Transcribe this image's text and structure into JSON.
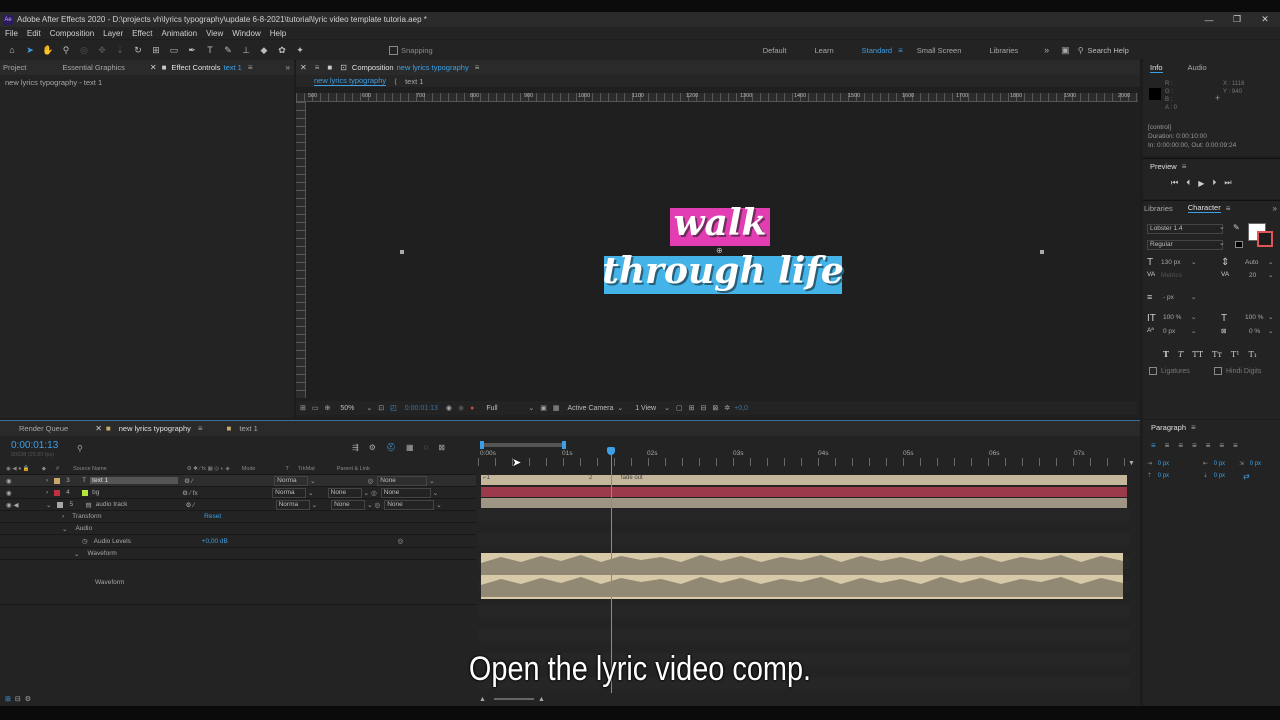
{
  "window": {
    "title": "Adobe After Effects 2020 - D:\\projects vh\\lyrics typography\\update 6-8-2021\\tutorial\\lyric video template tutoria.aep *",
    "app_icon": "Ae",
    "minimize": "—",
    "maximize": "❐",
    "close": "✕"
  },
  "menu": [
    "File",
    "Edit",
    "Composition",
    "Layer",
    "Effect",
    "Animation",
    "View",
    "Window",
    "Help"
  ],
  "toolbar": {
    "snapping_label": "Snapping",
    "workspaces": [
      "Default",
      "Learn",
      "Standard",
      "Small Screen",
      "Libraries"
    ],
    "active_workspace": "Standard",
    "search_placeholder": "Search Help"
  },
  "left_panel": {
    "tabs": [
      "Project",
      "Essential Graphics",
      "Effect Controls"
    ],
    "effect_controls_target": "text 1",
    "breadcrumb": "new lyrics typography - text 1"
  },
  "composition": {
    "tab_label": "Composition",
    "tab_target": "new lyrics typography",
    "nav_items": [
      "new lyrics typography",
      "text 1"
    ],
    "canvas_text_line1": "walk",
    "canvas_text_line2": "through life",
    "footer": {
      "zoom": "50%",
      "timecode": "0:00:01:13",
      "resolution": "Full",
      "camera": "Active Camera",
      "views": "1 View",
      "exposure": "+0,0"
    },
    "ruler_labels": [
      "500",
      "600",
      "700",
      "800",
      "900",
      "1000",
      "1100",
      "1200",
      "1300",
      "1400",
      "1500",
      "1600",
      "1700",
      "1800",
      "1900",
      "2000"
    ]
  },
  "info_panel": {
    "tabs": [
      "Info",
      "Audio"
    ],
    "rgb": [
      "R :",
      "G :",
      "B :",
      "A : 0"
    ],
    "xy": [
      "X : 1116",
      "Y : 940"
    ],
    "layer_info": [
      "[control]",
      "Duration: 0:00:10:00",
      "In: 0:00:00:00, Out: 0:00:09:24"
    ]
  },
  "preview_panel": {
    "title": "Preview"
  },
  "character_panel": {
    "tabs": [
      "Libraries",
      "Character"
    ],
    "font": "Lobster 1.4",
    "style": "Regular",
    "size": "130 px",
    "leading": "Auto",
    "kerning": "Metrics",
    "tracking": "20",
    "stroke": "- px",
    "vscale": "100 %",
    "hscale": "100 %",
    "baseline": "0 px",
    "tsume": "0 %",
    "style_buttons": [
      "T",
      "T",
      "TT",
      "Tᴛ",
      "T¹",
      "T₁"
    ],
    "ligatures": "Ligatures",
    "hindi_digits": "Hindi Digits"
  },
  "paragraph_panel": {
    "title": "Paragraph",
    "values": [
      "0 px",
      "0 px",
      "0 px",
      "0 px",
      "0 px"
    ]
  },
  "timeline": {
    "tabs": [
      "Render Queue",
      "new lyrics typography",
      "text 1"
    ],
    "timecode": "0:00:01:13",
    "frame_info": "00038 (25.00 fps)",
    "columns": [
      "Source Name",
      "Mode",
      "T",
      "TrkMat",
      "Parent & Link"
    ],
    "layers": [
      {
        "num": "3",
        "name": "text 1",
        "mode": "Norma",
        "trkmat": "",
        "parent": "None",
        "color": "#c8a96a"
      },
      {
        "num": "4",
        "name": "bg",
        "mode": "Norma",
        "trkmat": "None",
        "parent": "None",
        "color": "#b3e63d"
      },
      {
        "num": "5",
        "name": "audio track",
        "mode": "Norma",
        "trkmat": "None",
        "parent": "None",
        "color": "#a8a8a8"
      }
    ],
    "props": {
      "transform": "Transform",
      "reset": "Reset",
      "audio": "Audio",
      "audio_levels": "Audio Levels",
      "audio_levels_value": "+0,00 dB",
      "waveform_group": "Waveform",
      "waveform": "Waveform"
    },
    "ruler": [
      "0:00s",
      "01s",
      "02s",
      "03s",
      "04s",
      "05s",
      "06s",
      "07s"
    ],
    "markers": [
      "2",
      "fade out"
    ]
  },
  "subtitle": "Open the lyric video comp."
}
